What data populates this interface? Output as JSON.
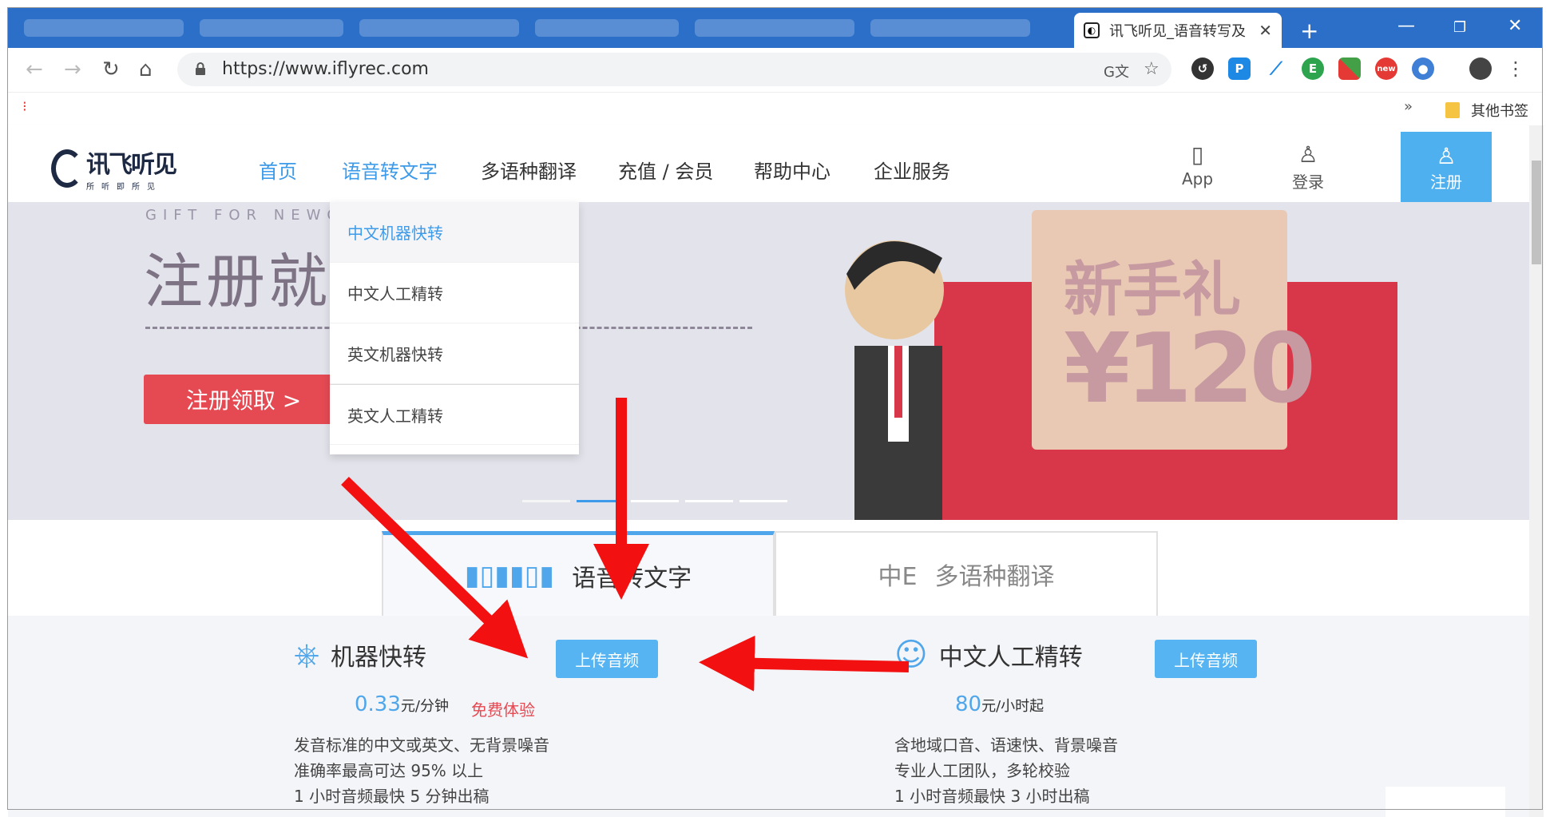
{
  "browser": {
    "tab_title": "讯飞听见_语音转写及",
    "url": "https://www.iflyrec.com",
    "other_bookmarks": "其他书签",
    "overflow": "»",
    "new_badge": "new"
  },
  "site": {
    "logo_main": "讯飞听见",
    "logo_sub": "所听即所见",
    "nav": [
      "首页",
      "语音转文字",
      "多语种翻译",
      "充值 / 会员",
      "帮助中心",
      "企业服务"
    ],
    "active_nav": "首页",
    "hover_nav": "语音转文字",
    "app_label": "App",
    "login_label": "登录",
    "register_label": "注册"
  },
  "dropdown": {
    "items": [
      "中文机器快转",
      "中文人工精转",
      "英文机器快转",
      "英文人工精转"
    ]
  },
  "banner": {
    "gift_text": "GIFT FOR NEWCOMERS",
    "title": "注册就送新手礼",
    "button": "注册领取 >",
    "card_title": "新手礼",
    "card_amount": "¥120"
  },
  "product_tabs": [
    "语音转文字",
    "多语种翻译"
  ],
  "services": [
    {
      "name": "机器快转",
      "button": "上传音频",
      "price": "0.33",
      "unit": "元/分钟",
      "free": "免费体验",
      "desc": [
        "发音标准的中文或英文、无背景噪音",
        "准确率最高可达 95% 以上",
        "1 小时音频最快 5 分钟出稿"
      ]
    },
    {
      "name": "中文人工精转",
      "button": "上传音频",
      "price": "80",
      "unit": "元/小时起",
      "desc": [
        "含地域口音、语速快、背景噪音",
        "专业人工团队，多轮校验",
        "1 小时音频最快 3 小时出稿"
      ]
    }
  ],
  "colors": {
    "accent": "#3d9be9",
    "button": "#55b4f1",
    "red": "#e54a53"
  }
}
